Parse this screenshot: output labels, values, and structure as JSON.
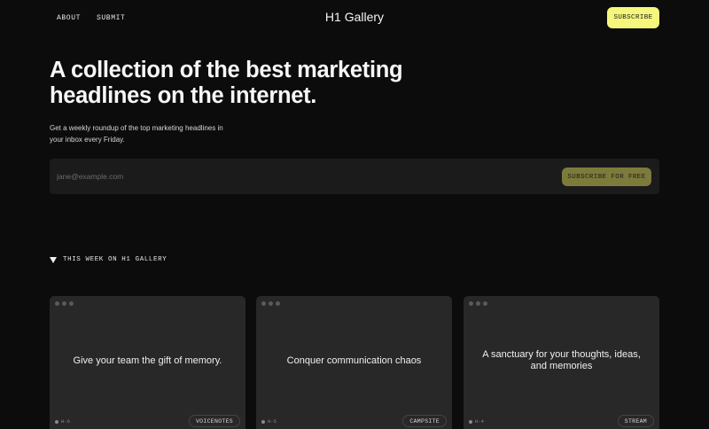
{
  "nav": {
    "about": "ABOUT",
    "submit": "SUBMIT",
    "brand": "H1 Gallery",
    "subscribe": "SUBSCRIBE"
  },
  "hero": {
    "title": "A collection of the best marketing headlines on the internet.",
    "subtitle": "Get a weekly roundup of the top marketing headlines in your inbox every Friday."
  },
  "form": {
    "email_placeholder": "jane@example.com",
    "email_value": "",
    "button": "SUBSCRIBE FOR FREE"
  },
  "week": {
    "icon": "triangle-down-icon",
    "label": "THIS WEEK ON H1 GALLERY"
  },
  "cards": [
    {
      "headline": "Give your team the gift of memory.",
      "id": "H-6",
      "tag": "VOICENOTES"
    },
    {
      "headline": "Conquer communication chaos",
      "id": "H-5",
      "tag": "CAMPSITE"
    },
    {
      "headline": "A sanctuary for your thoughts, ideas, and memories",
      "id": "H-4",
      "tag": "STREAM"
    }
  ],
  "colors": {
    "background": "#0c0c0c",
    "accent": "#f4f77b",
    "accent_muted": "#7c7b3c",
    "card": "#282828"
  }
}
